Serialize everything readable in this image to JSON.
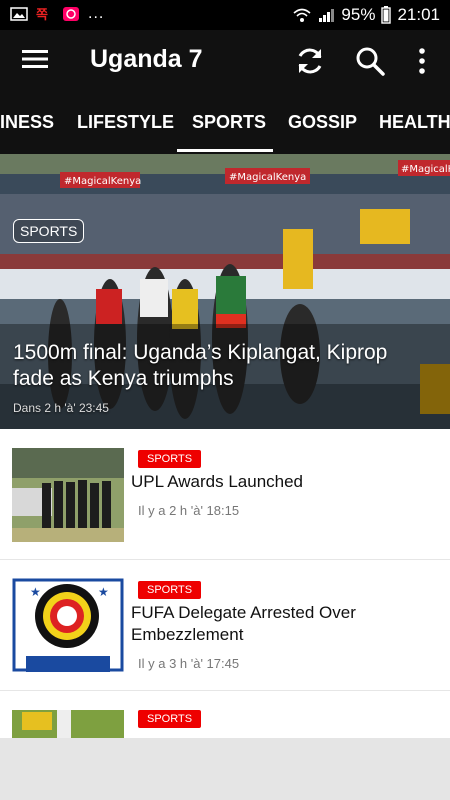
{
  "status_bar": {
    "notification_dots": "...",
    "battery": "95%",
    "time": "21:01"
  },
  "app_bar": {
    "title": "Uganda 7"
  },
  "tabs": [
    {
      "label": "INESS",
      "selected": false
    },
    {
      "label": "LIFESTYLE",
      "selected": false
    },
    {
      "label": "SPORTS",
      "selected": true
    },
    {
      "label": "GOSSIP",
      "selected": false
    },
    {
      "label": "HEALTH",
      "selected": false
    }
  ],
  "hero": {
    "category": "SPORTS",
    "headline": "1500m final: Uganda’s Kiplangat, Kiprop fade as Kenya triumphs",
    "time": "Dans 2 h 'à' 23:45",
    "banner_text": "#MagicalKenya"
  },
  "articles": [
    {
      "category": "SPORTS",
      "title": "UPL Awards  Launched",
      "time": "Il y a 2 h 'à' 18:15"
    },
    {
      "category": "SPORTS",
      "title": "FUFA Delegate Arrested Over Embezzlement",
      "time": "Il y a 3 h 'à' 17:45"
    },
    {
      "category": "SPORTS",
      "title": "",
      "time": ""
    }
  ],
  "colors": {
    "appbar": "#111111",
    "category_badge": "#ee0000",
    "background": "#e5e5e5"
  }
}
